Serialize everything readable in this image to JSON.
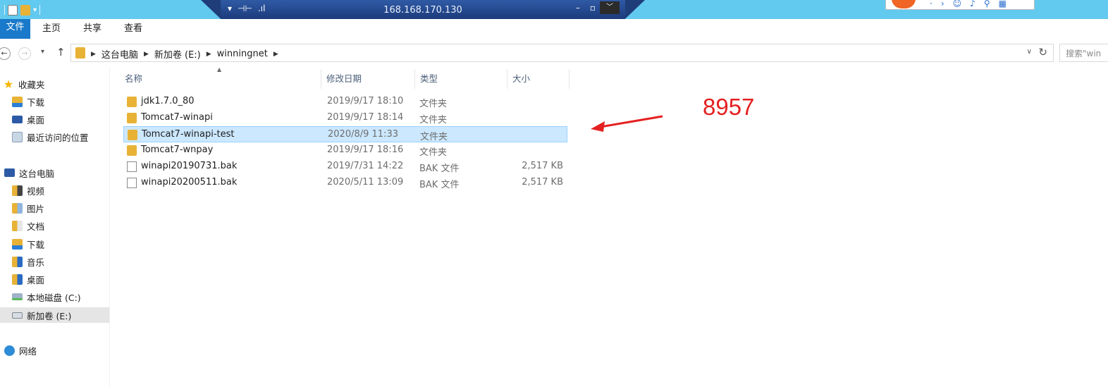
{
  "remote": {
    "ip": "168.168.170.130"
  },
  "ribbon": {
    "tabs": [
      "文件",
      "主页",
      "共享",
      "查看"
    ]
  },
  "address": {
    "crumbs": [
      "这台电脑",
      "新加卷 (E:)",
      "winningnet"
    ],
    "search_placeholder": "搜索\"win"
  },
  "sidebar": {
    "favorites": {
      "label": "收藏夹",
      "items": [
        "下载",
        "桌面",
        "最近访问的位置"
      ]
    },
    "this_pc": {
      "label": "这台电脑",
      "items": [
        "视频",
        "图片",
        "文档",
        "下载",
        "音乐",
        "桌面",
        "本地磁盘 (C:)",
        "新加卷 (E:)"
      ]
    },
    "network": {
      "label": "网络"
    }
  },
  "columns": [
    "名称",
    "修改日期",
    "类型",
    "大小"
  ],
  "files": [
    {
      "name": "jdk1.7.0_80",
      "date": "2019/9/17 18:10",
      "type": "文件夹",
      "size": "",
      "icon": "folder-icon"
    },
    {
      "name": "Tomcat7-winapi",
      "date": "2019/9/17 18:14",
      "type": "文件夹",
      "size": "",
      "icon": "folder-icon"
    },
    {
      "name": "Tomcat7-winapi-test",
      "date": "2020/8/9 11:33",
      "type": "文件夹",
      "size": "",
      "icon": "folder-icon",
      "selected": true
    },
    {
      "name": "Tomcat7-wnpay",
      "date": "2019/9/17 18:16",
      "type": "文件夹",
      "size": "",
      "icon": "folder-icon"
    },
    {
      "name": "winapi20190731.bak",
      "date": "2019/7/31 14:22",
      "type": "BAK 文件",
      "size": "2,517 KB",
      "icon": "file-icon"
    },
    {
      "name": "winapi20200511.bak",
      "date": "2020/5/11 13:09",
      "type": "BAK 文件",
      "size": "2,517 KB",
      "icon": "file-icon"
    }
  ],
  "annotation": {
    "text": "8957",
    "color": "#e52020"
  },
  "colors": {
    "titlebar": "#62c9ef",
    "file_tab": "#1979ca",
    "selection": "#cce8ff",
    "folder": "#e8b236"
  }
}
